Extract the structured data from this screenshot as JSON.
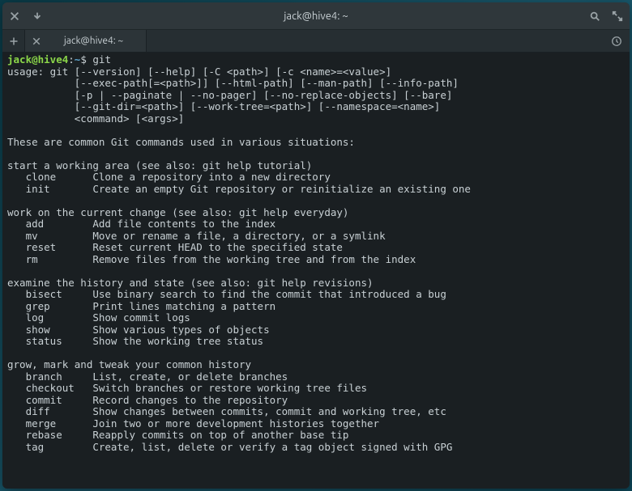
{
  "titlebar": {
    "title": "jack@hive4: ~"
  },
  "tab": {
    "label": "jack@hive4: ~"
  },
  "prompt": {
    "user_host": "jack@hive4",
    "sep": ":",
    "path": "~",
    "dollar": "$ ",
    "command": "git"
  },
  "output": {
    "usage1": "usage: git [--version] [--help] [-C <path>] [-c <name>=<value>]",
    "usage2": "           [--exec-path[=<path>]] [--html-path] [--man-path] [--info-path]",
    "usage3": "           [-p | --paginate | --no-pager] [--no-replace-objects] [--bare]",
    "usage4": "           [--git-dir=<path>] [--work-tree=<path>] [--namespace=<name>]",
    "usage5": "           <command> [<args>]",
    "blank": "",
    "intro": "These are common Git commands used in various situations:",
    "sec1_title": "start a working area (see also: git help tutorial)",
    "sec1_l1": "   clone      Clone a repository into a new directory",
    "sec1_l2": "   init       Create an empty Git repository or reinitialize an existing one",
    "sec2_title": "work on the current change (see also: git help everyday)",
    "sec2_l1": "   add        Add file contents to the index",
    "sec2_l2": "   mv         Move or rename a file, a directory, or a symlink",
    "sec2_l3": "   reset      Reset current HEAD to the specified state",
    "sec2_l4": "   rm         Remove files from the working tree and from the index",
    "sec3_title": "examine the history and state (see also: git help revisions)",
    "sec3_l1": "   bisect     Use binary search to find the commit that introduced a bug",
    "sec3_l2": "   grep       Print lines matching a pattern",
    "sec3_l3": "   log        Show commit logs",
    "sec3_l4": "   show       Show various types of objects",
    "sec3_l5": "   status     Show the working tree status",
    "sec4_title": "grow, mark and tweak your common history",
    "sec4_l1": "   branch     List, create, or delete branches",
    "sec4_l2": "   checkout   Switch branches or restore working tree files",
    "sec4_l3": "   commit     Record changes to the repository",
    "sec4_l4": "   diff       Show changes between commits, commit and working tree, etc",
    "sec4_l5": "   merge      Join two or more development histories together",
    "sec4_l6": "   rebase     Reapply commits on top of another base tip",
    "sec4_l7": "   tag        Create, list, delete or verify a tag object signed with GPG"
  }
}
